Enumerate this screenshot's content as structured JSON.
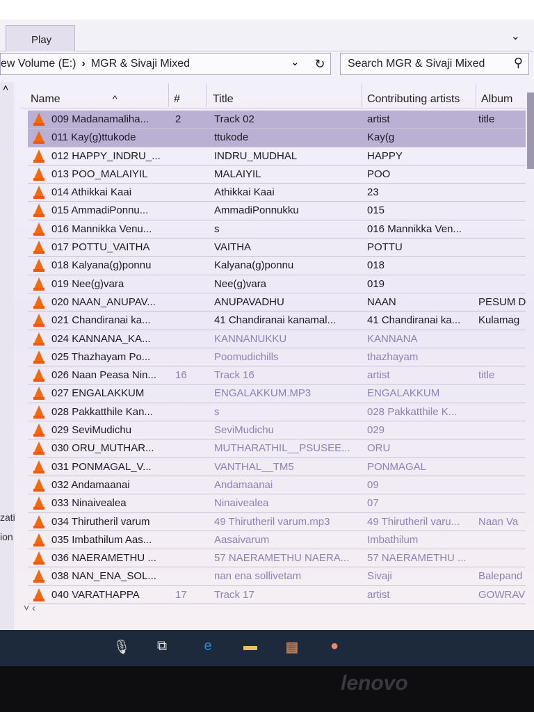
{
  "ribbon": {
    "tab": "Play"
  },
  "address": {
    "segments": [
      "ew Volume (E:)",
      "MGR & Sivaji Mixed"
    ]
  },
  "search": {
    "placeholder": "Search MGR & Sivaji Mixed"
  },
  "nav": {
    "partial_labels": [
      "zati",
      "ion"
    ]
  },
  "columns": {
    "name": "Name",
    "num": "#",
    "title": "Title",
    "artists": "Contributing artists",
    "album": "Album"
  },
  "files": [
    {
      "name": "009 Madanamaliha...",
      "num": "2",
      "title": "Track 02",
      "artist": "artist",
      "album": "title"
    },
    {
      "name": "011 Kay(g)ttukode",
      "num": "",
      "title": "ttukode",
      "artist": "Kay(g",
      "album": ""
    },
    {
      "name": "012 HAPPY_INDRU_...",
      "num": "",
      "title": "INDRU_MUDHAL",
      "artist": "HAPPY",
      "album": ""
    },
    {
      "name": "013 POO_MALAIYIL",
      "num": "",
      "title": "MALAIYIL",
      "artist": "POO",
      "album": ""
    },
    {
      "name": "014 Athikkai Kaai",
      "num": "",
      "title": "Athikkai Kaai",
      "artist": "23",
      "album": ""
    },
    {
      "name": "015 AmmadiPonnu...",
      "num": "",
      "title": "AmmadiPonnukku",
      "artist": "015",
      "album": ""
    },
    {
      "name": "016 Mannikka Venu...",
      "num": "",
      "title": "s",
      "artist": "016 Mannikka Ven...",
      "album": ""
    },
    {
      "name": "017 POTTU_VAITHA",
      "num": "",
      "title": "VAITHA",
      "artist": "POTTU",
      "album": ""
    },
    {
      "name": "018 Kalyana(g)ponnu",
      "num": "",
      "title": "Kalyana(g)ponnu",
      "artist": "018",
      "album": ""
    },
    {
      "name": "019 Nee(g)vara",
      "num": "",
      "title": "Nee(g)vara",
      "artist": "019",
      "album": ""
    },
    {
      "name": "020 NAAN_ANUPAV...",
      "num": "",
      "title": "ANUPAVADHU",
      "artist": "NAAN",
      "album": "PESUM D"
    },
    {
      "name": "021 Chandiranai ka...",
      "num": "",
      "title": "41 Chandiranai kanamal...",
      "artist": "41 Chandiranai ka...",
      "album": "Kulamag"
    },
    {
      "name": "024 KANNANA_KA...",
      "num": "",
      "title": "KANNANUKKU",
      "artist": "KANNANA",
      "album": ""
    },
    {
      "name": "025 Thazhayam Po...",
      "num": "",
      "title": "Poomudichills",
      "artist": "thazhayam",
      "album": ""
    },
    {
      "name": "026 Naan Peasa Nin...",
      "num": "16",
      "title": "Track 16",
      "artist": "artist",
      "album": "title"
    },
    {
      "name": "027 ENGALAKKUM",
      "num": "",
      "title": "ENGALAKKUM.MP3",
      "artist": "ENGALAKKUM",
      "album": ""
    },
    {
      "name": "028  Pakkatthile Kan...",
      "num": "",
      "title": "s",
      "artist": "028  Pakkatthile K...",
      "album": ""
    },
    {
      "name": "029 SeviMudichu",
      "num": "",
      "title": "SeviMudichu",
      "artist": "029",
      "album": ""
    },
    {
      "name": "030 ORU_MUTHAR...",
      "num": "",
      "title": "MUTHARATHIL__PSUSEE...",
      "artist": "ORU",
      "album": ""
    },
    {
      "name": "031 PONMAGAL_V...",
      "num": "",
      "title": "VANTHAL__TM5",
      "artist": "PONMAGAL",
      "album": ""
    },
    {
      "name": "032  Andamaanai",
      "num": "",
      "title": "Andamaanai",
      "artist": "09",
      "album": ""
    },
    {
      "name": "033  Ninaivealea",
      "num": "",
      "title": "Ninaivealea",
      "artist": "07",
      "album": ""
    },
    {
      "name": "034 Thirutheril varum",
      "num": "",
      "title": "49 Thirutheril varum.mp3",
      "artist": "49 Thirutheril varu...",
      "album": "Naan Va"
    },
    {
      "name": "035 Imbathilum Aas...",
      "num": "",
      "title": "Aasaivarum",
      "artist": "Imbathilum",
      "album": ""
    },
    {
      "name": "036 NAERAMETHU ...",
      "num": "",
      "title": "57 NAERAMETHU NAERA...",
      "artist": "57 NAERAMETHU ...",
      "album": ""
    },
    {
      "name": "038 NAN_ENA_SOL...",
      "num": "",
      "title": "nan ena sollivetam",
      "artist": "Sivaji",
      "album": "Balepand"
    },
    {
      "name": "040 VARATHAPPA",
      "num": "17",
      "title": "Track 17",
      "artist": "artist",
      "album": "GOWRAV"
    }
  ],
  "brand": "lenovo"
}
